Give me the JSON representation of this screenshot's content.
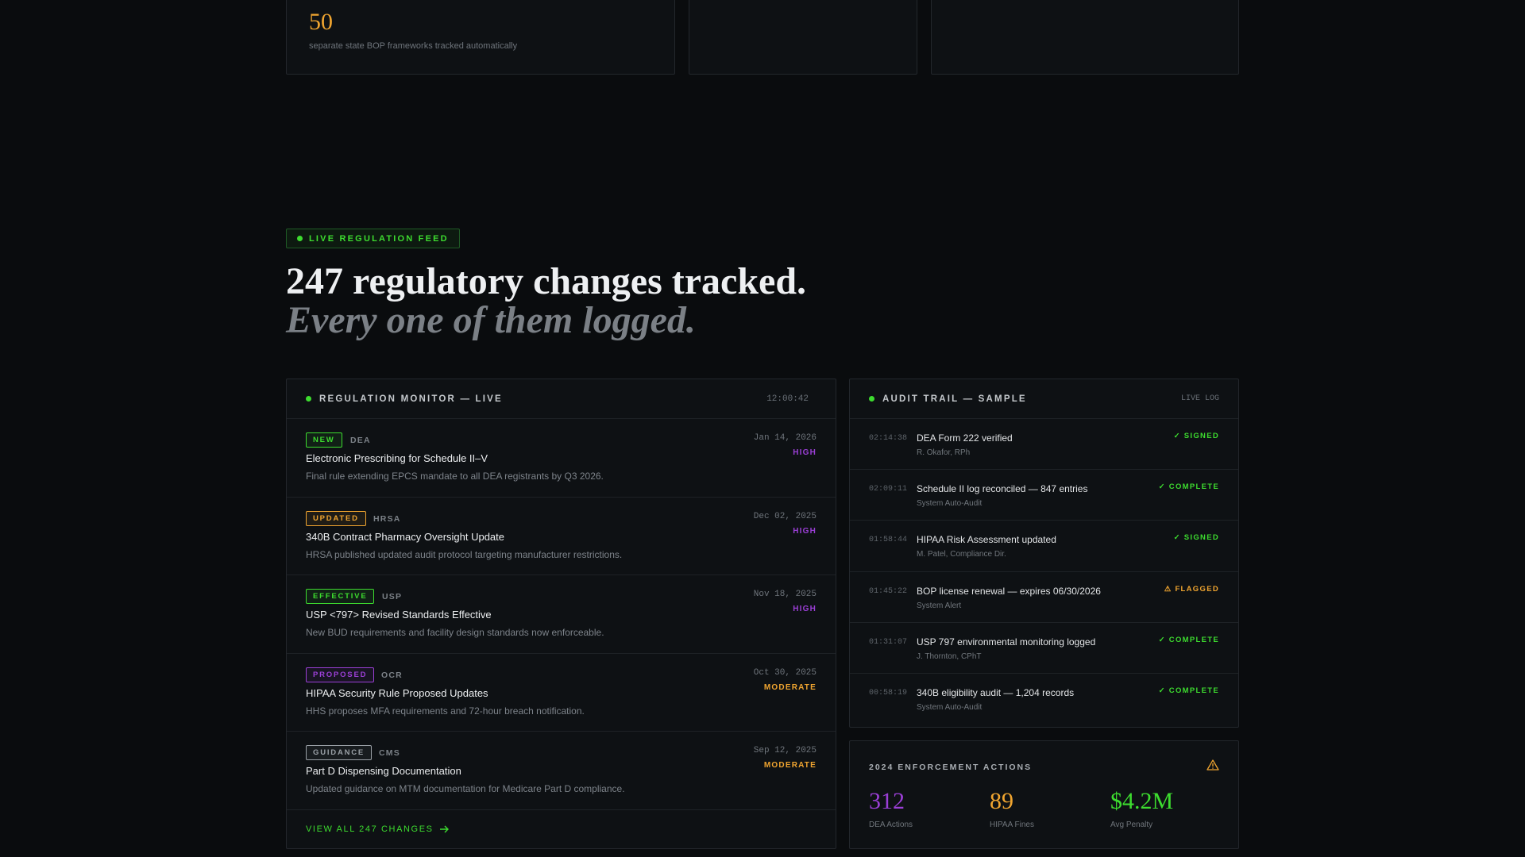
{
  "top_cards": [
    {
      "value": "50",
      "caption": "separate state BOP frameworks tracked automatically"
    },
    {
      "value": "",
      "caption": ""
    },
    {
      "value": "",
      "caption": ""
    }
  ],
  "feed_badge": "LIVE REGULATION FEED",
  "headline": "247 regulatory changes tracked.",
  "subheadline": "Every one of them logged.",
  "monitor": {
    "title": "REGULATION MONITOR — LIVE",
    "time": "12:00:42",
    "items": [
      {
        "tag": "NEW",
        "tag_color": "#3ddc2f",
        "agency": "DEA",
        "date": "Jan 14, 2026",
        "severity": "HIGH",
        "severity_color": "#9b3fd6",
        "title": "Electronic Prescribing for Schedule II–V",
        "desc": "Final rule extending EPCS mandate to all DEA registrants by Q3 2026."
      },
      {
        "tag": "UPDATED",
        "tag_color": "#f0a530",
        "agency": "HRSA",
        "date": "Dec 02, 2025",
        "severity": "HIGH",
        "severity_color": "#9b3fd6",
        "title": "340B Contract Pharmacy Oversight Update",
        "desc": "HRSA published updated audit protocol targeting manufacturer restrictions."
      },
      {
        "tag": "EFFECTIVE",
        "tag_color": "#3ddc2f",
        "agency": "USP",
        "date": "Nov 18, 2025",
        "severity": "HIGH",
        "severity_color": "#9b3fd6",
        "title": "USP <797> Revised Standards Effective",
        "desc": "New BUD requirements and facility design standards now enforceable."
      },
      {
        "tag": "PROPOSED",
        "tag_color": "#9b3fd6",
        "agency": "OCR",
        "date": "Oct 30, 2025",
        "severity": "MODERATE",
        "severity_color": "#f0a530",
        "title": "HIPAA Security Rule Proposed Updates",
        "desc": "HHS proposes MFA requirements and 72-hour breach notification."
      },
      {
        "tag": "GUIDANCE",
        "tag_color": "#9aa0a6",
        "agency": "CMS",
        "date": "Sep 12, 2025",
        "severity": "MODERATE",
        "severity_color": "#f0a530",
        "title": "Part D Dispensing Documentation",
        "desc": "Updated guidance on MTM documentation for Medicare Part D compliance."
      }
    ],
    "view_all": "VIEW ALL 247 CHANGES"
  },
  "audit": {
    "title": "AUDIT TRAIL — SAMPLE",
    "tag": "LIVE LOG",
    "items": [
      {
        "time": "02:14:38",
        "title": "DEA Form 222 verified",
        "sub": "R. Okafor, RPh",
        "status": "✓ SIGNED",
        "status_color": "#3ddc2f"
      },
      {
        "time": "02:09:11",
        "title": "Schedule II log reconciled — 847 entries",
        "sub": "System Auto-Audit",
        "status": "✓ COMPLETE",
        "status_color": "#3ddc2f"
      },
      {
        "time": "01:58:44",
        "title": "HIPAA Risk Assessment updated",
        "sub": "M. Patel, Compliance Dir.",
        "status": "✓ SIGNED",
        "status_color": "#3ddc2f"
      },
      {
        "time": "01:45:22",
        "title": "BOP license renewal — expires 06/30/2026",
        "sub": "System Alert",
        "status": "⚠ FLAGGED",
        "status_color": "#f0a530"
      },
      {
        "time": "01:31:07",
        "title": "USP 797 environmental monitoring logged",
        "sub": "J. Thornton, CPhT",
        "status": "✓ COMPLETE",
        "status_color": "#3ddc2f"
      },
      {
        "time": "00:58:19",
        "title": "340B eligibility audit — 1,204 records",
        "sub": "System Auto-Audit",
        "status": "✓ COMPLETE",
        "status_color": "#3ddc2f"
      }
    ]
  },
  "enforcement": {
    "title": "2024 ENFORCEMENT ACTIONS",
    "icon": "warning-icon",
    "stats": [
      {
        "value": "312",
        "label": "DEA Actions",
        "color": "#9b3fd6"
      },
      {
        "value": "89",
        "label": "HIPAA Fines",
        "color": "#f0a530"
      },
      {
        "value": "$4.2M",
        "label": "Avg Penalty",
        "color": "#3ddc2f"
      }
    ]
  },
  "colors": {
    "accent_green": "#3ddc2f",
    "accent_amber": "#f0a530",
    "accent_purple": "#9b3fd6",
    "background": "#0a0c0e"
  }
}
